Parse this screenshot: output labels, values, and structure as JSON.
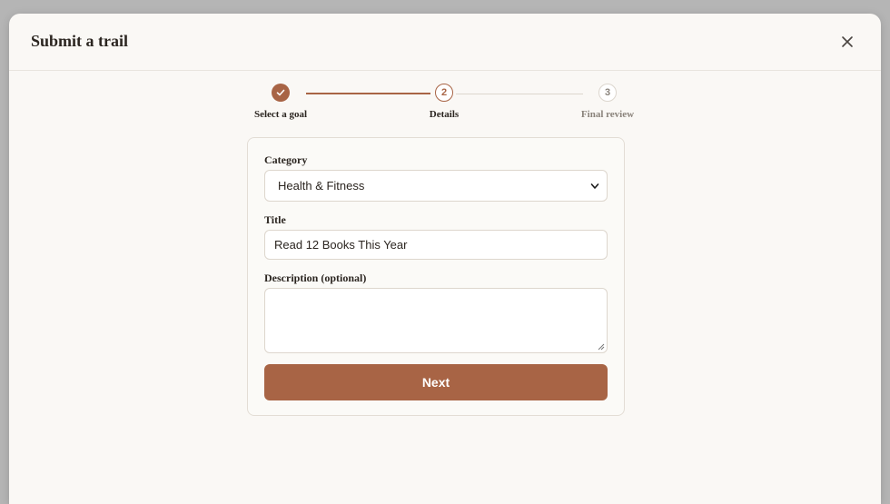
{
  "modal": {
    "title": "Submit a trail"
  },
  "stepper": {
    "steps": [
      {
        "number": "1",
        "label": "Select a goal",
        "state": "completed"
      },
      {
        "number": "2",
        "label": "Details",
        "state": "current"
      },
      {
        "number": "3",
        "label": "Final review",
        "state": "upcoming"
      }
    ]
  },
  "form": {
    "category": {
      "label": "Category",
      "value": "Health & Fitness"
    },
    "title": {
      "label": "Title",
      "value": "Read 12 Books This Year"
    },
    "description": {
      "label": "Description (optional)",
      "value": ""
    },
    "next_label": "Next"
  },
  "colors": {
    "accent": "#a86445",
    "backdrop": "#b5b5b5",
    "surface": "#faf8f5",
    "upcoming_text": "#8a837b"
  },
  "icons": {
    "close": "close-icon",
    "check": "check-icon",
    "dropdown": "chevron-down-icon"
  }
}
